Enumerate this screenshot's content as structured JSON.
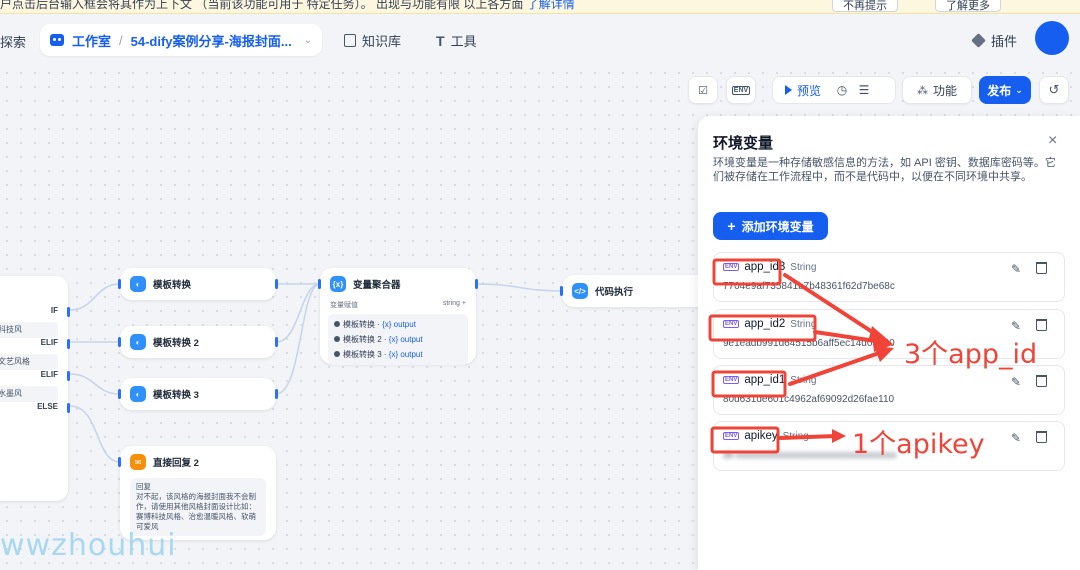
{
  "notice": {
    "text": "户点击后台输入框会将其作为上下文 （当前该功能可用于 特定任务）。 出现与功能有限 以上各方面",
    "link": "了解详情",
    "btn1": "不再提示",
    "btn2": "了解更多"
  },
  "header": {
    "explore": "探索",
    "studio": "工作室",
    "app_name": "54-dify案例分享-海报封面...",
    "knowledge": "知识库",
    "tools": "工具",
    "plugins": "插件"
  },
  "toolbar": {
    "preview": "预览",
    "features": "功能",
    "publish": "发布"
  },
  "nodes": {
    "if": {
      "labels": [
        "IF",
        "ELIF",
        "ELIF",
        "ELSE"
      ],
      "conds": [
        "科技风",
        "文艺风格",
        "水墨风"
      ]
    },
    "template1": "模板转换",
    "template2": "模板转换 2",
    "template3": "模板转换 3",
    "aggregator": {
      "title": "变量聚合器",
      "sub_label": "变量赋值",
      "sub_type": "string",
      "rows": [
        {
          "name": "模板转换",
          "var": "{x} output"
        },
        {
          "name": "模板转换 2",
          "var": "{x} output"
        },
        {
          "name": "模板转换 3",
          "var": "{x} output"
        }
      ]
    },
    "code": "代码执行",
    "reply": {
      "title": "直接回复 2",
      "label": "回复",
      "body": "对不起，该风格的海报封面我不会制作，请使用其他风格封面设计比如：赛博科技风格、治愈温暖风格、软萌可爱风"
    }
  },
  "env_panel": {
    "title": "环境变量",
    "description": "环境变量是一种存储敏感信息的方法，如 API 密钥、数据库密码等。它们被存储在工作流程中，而不是代码中，以便在不同环境中共享。",
    "add_button": "添加环境变量",
    "vars": [
      {
        "name": "app_id3",
        "type": "String",
        "value": "7704e9af735841b7b48361f62d7be68c"
      },
      {
        "name": "app_id2",
        "type": "String",
        "value": "9e1eadb991d64515b6aff5ec14d03540"
      },
      {
        "name": "app_id1",
        "type": "String",
        "value": "80d631de601c4962af69092d26fae110"
      },
      {
        "name": "apikey",
        "type": "String",
        "value": "sk-xxxxxxxxxxxxxxxxxxxxxxxxxxxxxxxx"
      }
    ]
  },
  "annotations": {
    "app_id_note": "3个app_id",
    "apikey_note": "1个apikey"
  },
  "watermark": "wwzhouhui",
  "colors": {
    "accent": "#155eef",
    "annotation_red": "#f04438"
  }
}
